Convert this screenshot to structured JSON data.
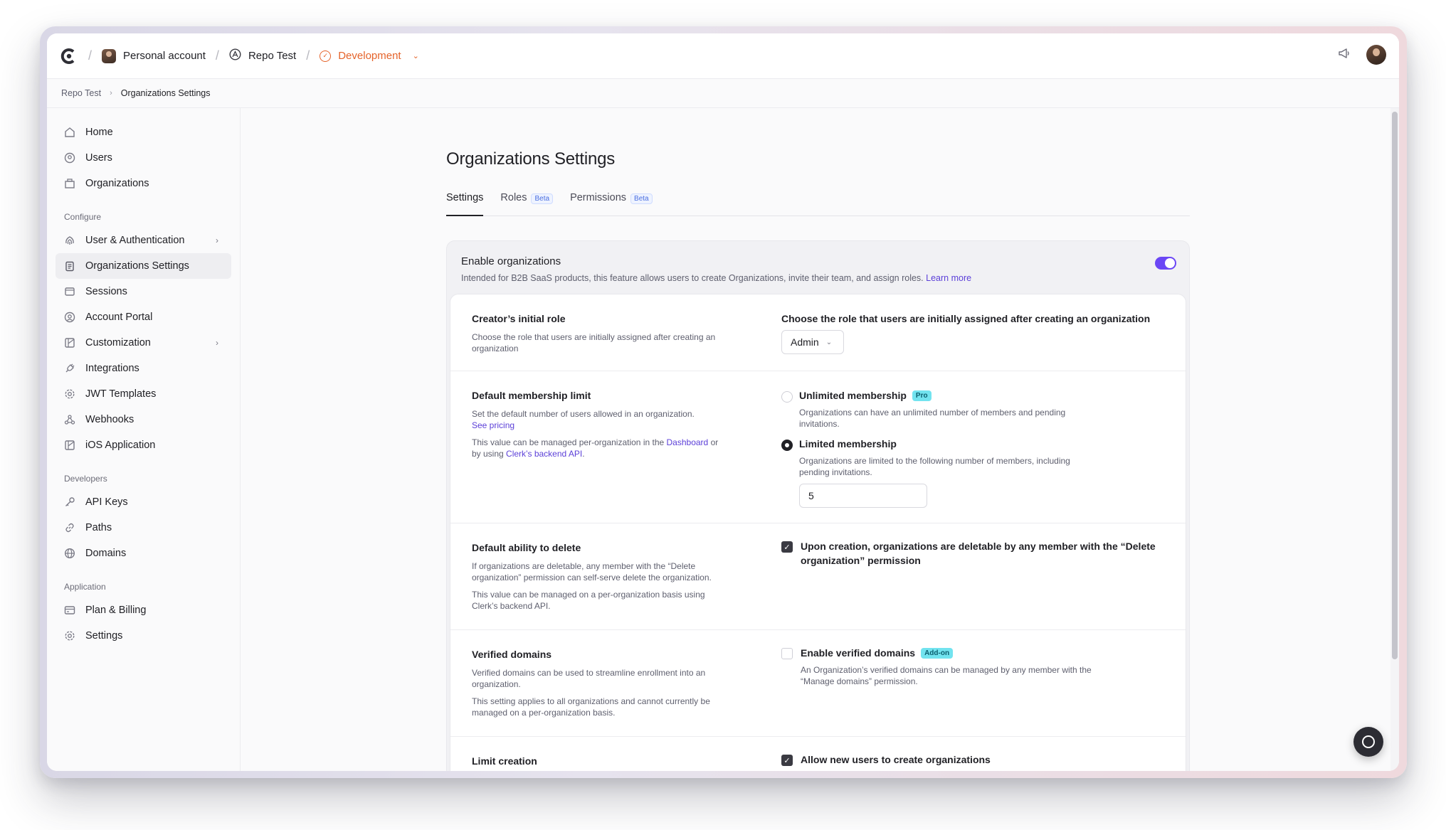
{
  "topbar": {
    "account_label": "Personal account",
    "app_label": "Repo Test",
    "env_label": "Development"
  },
  "breadcrumb": {
    "parent": "Repo Test",
    "current": "Organizations Settings"
  },
  "sidebar": {
    "main_items": [
      {
        "label": "Home",
        "icon": "home-icon"
      },
      {
        "label": "Users",
        "icon": "users-icon"
      },
      {
        "label": "Organizations",
        "icon": "building-icon"
      }
    ],
    "configure_title": "Configure",
    "configure_items": [
      {
        "label": "User & Authentication",
        "icon": "fingerprint-icon"
      },
      {
        "label": "Organizations Settings",
        "icon": "clipboard-icon"
      },
      {
        "label": "Sessions",
        "icon": "sessions-icon"
      },
      {
        "label": "Account Portal",
        "icon": "user-circle-icon"
      },
      {
        "label": "Customization",
        "icon": "brush-icon"
      },
      {
        "label": "Integrations",
        "icon": "plug-icon"
      },
      {
        "label": "JWT Templates",
        "icon": "cog-icon"
      },
      {
        "label": "Webhooks",
        "icon": "webhook-icon"
      },
      {
        "label": "iOS Application",
        "icon": "mobile-icon"
      }
    ],
    "developers_title": "Developers",
    "developers_items": [
      {
        "label": "API Keys",
        "icon": "key-icon"
      },
      {
        "label": "Paths",
        "icon": "link-icon"
      },
      {
        "label": "Domains",
        "icon": "globe-icon"
      }
    ],
    "application_title": "Application",
    "application_items": [
      {
        "label": "Plan & Billing",
        "icon": "card-icon"
      },
      {
        "label": "Settings",
        "icon": "settings-icon"
      }
    ]
  },
  "page": {
    "title": "Organizations Settings",
    "tabs": [
      {
        "label": "Settings",
        "badge": ""
      },
      {
        "label": "Roles",
        "badge": "Beta"
      },
      {
        "label": "Permissions",
        "badge": "Beta"
      }
    ]
  },
  "enable": {
    "title": "Enable organizations",
    "description": "Intended for B2B SaaS products, this feature allows users to create Organizations, invite their team, and assign roles.",
    "learn_more": "Learn more",
    "enabled": true
  },
  "creator_role": {
    "title": "Creator’s initial role",
    "description": "Choose the role that users are initially assigned after creating an organization",
    "right_title": "Choose the role that users are initially assigned after creating an organization",
    "value": "Admin"
  },
  "membership": {
    "title": "Default membership limit",
    "description": "Set the default number of users allowed in an organization.",
    "see_pricing": "See pricing",
    "note_before": "This value can be managed per-organization in the",
    "dashboard_link": "Dashboard",
    "note_middle": "or by using",
    "api_link": "Clerk’s backend API",
    "note_end": ".",
    "unlimited_label": "Unlimited membership",
    "unlimited_badge": "Pro",
    "unlimited_desc": "Organizations can have an unlimited number of members and pending invitations.",
    "limited_label": "Limited membership",
    "limited_desc": "Organizations are limited to the following number of members, including pending invitations.",
    "limit_value": "5"
  },
  "delete": {
    "title": "Default ability to delete",
    "desc1": "If organizations are deletable, any member with the “Delete organization” permission can self-serve delete the organization.",
    "desc2": "This value can be managed on a per-organization basis using Clerk’s backend API.",
    "checkbox_label": "Upon creation, organizations are deletable by any member with the “Delete organization” permission"
  },
  "verified": {
    "title": "Verified domains",
    "desc1": "Verified domains can be used to streamline enrollment into an organization.",
    "desc2": "This setting applies to all organizations and cannot currently be managed on a per-organization basis.",
    "checkbox_label": "Enable verified domains",
    "badge": "Add-on",
    "checkbox_desc": "An Organization’s verified domains can be managed by any member with the “Manage domains” permission."
  },
  "limit_creation": {
    "title": "Limit creation",
    "checkbox_label": "Allow new users to create organizations"
  }
}
